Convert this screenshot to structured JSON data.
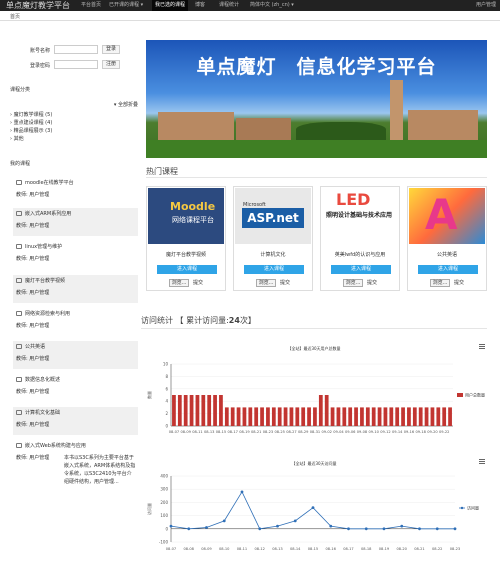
{
  "topbar": {
    "brand": "单点魔灯教学平台",
    "nav": [
      "平台首页",
      "已开课的课程 ▾",
      "我已选的课程",
      "博客",
      "课程统计",
      "简体中文 (zh_cn) ▾"
    ],
    "active_index": 2,
    "user": "用户管理"
  },
  "breadcrumb": "首页",
  "login": {
    "username_label": "账号名称",
    "password_label": "登录密码",
    "login_button": "登录",
    "register_button": "注册"
  },
  "categories": {
    "title": "课程分类",
    "expand_all": "全部折叠",
    "items": [
      "魔灯教学课程 (5)",
      "重点建设课程 (4)",
      "精品课程展示 (3)",
      "其他"
    ]
  },
  "my_courses": {
    "title": "我的课程",
    "items": [
      {
        "name": "moodle在线教学平台",
        "meta": "教师: 用户管理"
      },
      {
        "name": "嵌入式ARM系列应用",
        "meta": "教师: 用户管理"
      },
      {
        "name": "linux管理与维护",
        "meta": "教师: 用户管理"
      },
      {
        "name": "魔灯平台教学视频",
        "meta": "教师: 用户管理"
      },
      {
        "name": "网络资源检索与利用",
        "meta": "教师: 用户管理"
      },
      {
        "name": "公共英语",
        "meta": "教师: 用户管理"
      },
      {
        "name": "数据信息化概述",
        "meta": "教师: 用户管理"
      },
      {
        "name": "计算机文化基础",
        "meta": "教师: 用户管理"
      },
      {
        "name": "嵌入式Web系统构建与应用",
        "meta": "教师: 用户管理",
        "desc": "本书以S3C系列为主要平台基于嵌入式系统，ARM体系结构及指令系统，以S3C2410为平台介绍硬件结构，用户管理..."
      }
    ]
  },
  "banner": {
    "title": "单点魔灯　信息化学习平台"
  },
  "hot_courses": {
    "title": "热门课程",
    "enter_label": "进入课程",
    "browse_label": "浏览...",
    "submit_label": "提交",
    "items": [
      {
        "name": "魔灯平台教学视频",
        "img_text1": "Moodle",
        "img_text2": "网络课程平台"
      },
      {
        "name": "计算机文化",
        "img_text1": "Microsoft",
        "img_text2": "ASP.net"
      },
      {
        "name": "英美lwfd的认识与应用",
        "img_text1": "LED",
        "img_text2": "照明设计基础与技术应用"
      },
      {
        "name": "公共英语",
        "img_text1": "A",
        "img_text2": ""
      }
    ]
  },
  "visits": {
    "label": "访问统计",
    "total_prefix": "【 累计访问量:",
    "total_value": "24",
    "total_suffix": "次】"
  },
  "chart_data": [
    {
      "type": "bar",
      "title": "【全站】最近30天用户总数量",
      "ylabel": "数量",
      "legend": "用户总数量",
      "legend_position": "right",
      "ylim": [
        0,
        10
      ],
      "categories": [
        "08-07",
        "08-08",
        "08-09",
        "08-10",
        "08-11",
        "08-12",
        "08-13",
        "08-14",
        "08-15",
        "08-16",
        "08-17",
        "08-18",
        "08-19",
        "08-20",
        "08-21",
        "08-22",
        "08-23",
        "08-24",
        "08-25",
        "08-26",
        "08-27",
        "08-28",
        "08-29",
        "08-30",
        "08-31",
        "09-01",
        "09-02",
        "09-03",
        "09-04",
        "09-05",
        "09-06",
        "09-07",
        "09-08",
        "09-09",
        "09-10",
        "09-11",
        "09-12",
        "09-13",
        "09-14",
        "09-15",
        "09-16",
        "09-17",
        "09-18",
        "09-19",
        "09-20",
        "09-21",
        "09-22",
        "09-23"
      ],
      "values": [
        5,
        5,
        5,
        5,
        5,
        5,
        5,
        5,
        5,
        3,
        3,
        3,
        3,
        3,
        3,
        3,
        3,
        3,
        3,
        3,
        3,
        3,
        3,
        3,
        3,
        5,
        5,
        3,
        3,
        3,
        3,
        3,
        3,
        3,
        3,
        3,
        3,
        3,
        3,
        3,
        3,
        3,
        3,
        3,
        3,
        3,
        3,
        3
      ]
    },
    {
      "type": "line",
      "title": "【全站】最近30天访问量",
      "ylabel": "访问量",
      "legend": "访问量",
      "legend_position": "right",
      "ylim": [
        -100,
        400
      ],
      "categories": [
        "08-07",
        "08-08",
        "08-09",
        "08-10",
        "08-11",
        "08-12",
        "08-13",
        "08-14",
        "08-15",
        "08-16",
        "08-17",
        "08-18",
        "08-19",
        "08-20",
        "08-21",
        "08-22",
        "08-23"
      ],
      "values": [
        20,
        0,
        10,
        60,
        280,
        0,
        20,
        60,
        160,
        20,
        0,
        0,
        0,
        20,
        0,
        0,
        0
      ]
    }
  ],
  "colors": {
    "topbar": "#222222",
    "bar": "#c23531",
    "line": "#2f6fb7",
    "enter_button": "#2fa4e7"
  }
}
